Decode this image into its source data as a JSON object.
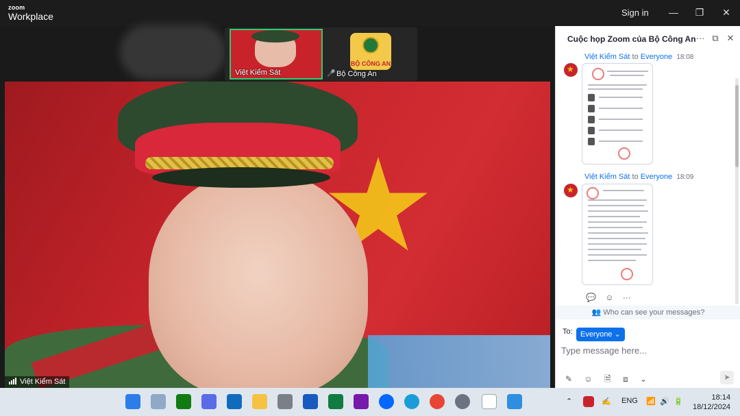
{
  "app": {
    "brand_small": "zoom",
    "brand_large": "Workplace",
    "signin": "Sign in",
    "minimize": "—",
    "restore": "❐",
    "close": "✕"
  },
  "thumbnails": [
    {
      "name": "Việt Kiểm Sát",
      "active": true
    },
    {
      "name": "Bộ Công An",
      "active": false,
      "badge_text": "BỘ CÔNG AN"
    }
  ],
  "main_video": {
    "name": "Việt Kiểm Sát"
  },
  "chat": {
    "title": "Cuộc họp Zoom của Bộ Công An",
    "more": "···",
    "popout": "⧉",
    "close": "✕",
    "messages": [
      {
        "sender": "Việt Kiểm Sát",
        "to": "to",
        "recipient": "Everyone",
        "time": "18:08"
      },
      {
        "sender": "Việt Kiểm Sát",
        "to": "to",
        "recipient": "Everyone",
        "time": "18:09"
      }
    ],
    "who_can_see": "Who can see your messages?",
    "to_label": "To:",
    "to_value": "Everyone",
    "input_placeholder": "Type message here..."
  },
  "taskbar": {
    "lang": "ENG",
    "time": "18:14",
    "date": "18/12/2024"
  },
  "colors": {
    "accent": "#0e71eb",
    "active_speaker": "#2ecc71",
    "flag_red": "#c7242b",
    "flag_star": "#f2c21a"
  }
}
